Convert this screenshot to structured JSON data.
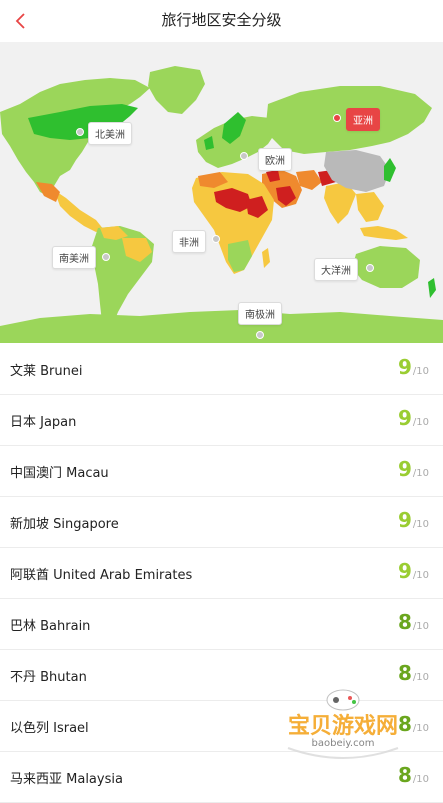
{
  "header": {
    "title": "旅行地区安全分级",
    "back_icon": "chevron-left-icon"
  },
  "map": {
    "labels": {
      "north_america": "北美洲",
      "europe": "欧洲",
      "asia": "亚洲",
      "africa": "非洲",
      "south_america": "南美洲",
      "oceania": "大洋洲",
      "antarctica": "南极洲"
    },
    "active_region": "亚洲",
    "colors": {
      "safe_dark": "#2fbf2f",
      "safe": "#9bd65a",
      "caution": "#f6c840",
      "warning": "#ef8a2e",
      "danger": "#cf1f1f",
      "no_data": "#b9b9b9",
      "accent": "#e84545"
    }
  },
  "rankings": [
    {
      "name": "文莱 Brunei",
      "score": "9",
      "max": "/10",
      "color": "#9acd32"
    },
    {
      "name": "日本 Japan",
      "score": "9",
      "max": "/10",
      "color": "#9acd32"
    },
    {
      "name": "中国澳门 Macau",
      "score": "9",
      "max": "/10",
      "color": "#9acd32"
    },
    {
      "name": "新加坡 Singapore",
      "score": "9",
      "max": "/10",
      "color": "#9acd32"
    },
    {
      "name": "阿联酋 United Arab Emirates",
      "score": "9",
      "max": "/10",
      "color": "#9acd32"
    },
    {
      "name": "巴林 Bahrain",
      "score": "8",
      "max": "/10",
      "color": "#6aa61e"
    },
    {
      "name": "不丹 Bhutan",
      "score": "8",
      "max": "/10",
      "color": "#6aa61e"
    },
    {
      "name": "以色列 Israel",
      "score": "8",
      "max": "/10",
      "color": "#6aa61e"
    },
    {
      "name": "马来西亚 Malaysia",
      "score": "8",
      "max": "/10",
      "color": "#6aa61e"
    }
  ],
  "watermark": {
    "text": "宝贝游戏网",
    "url": "baobeiy.com"
  }
}
